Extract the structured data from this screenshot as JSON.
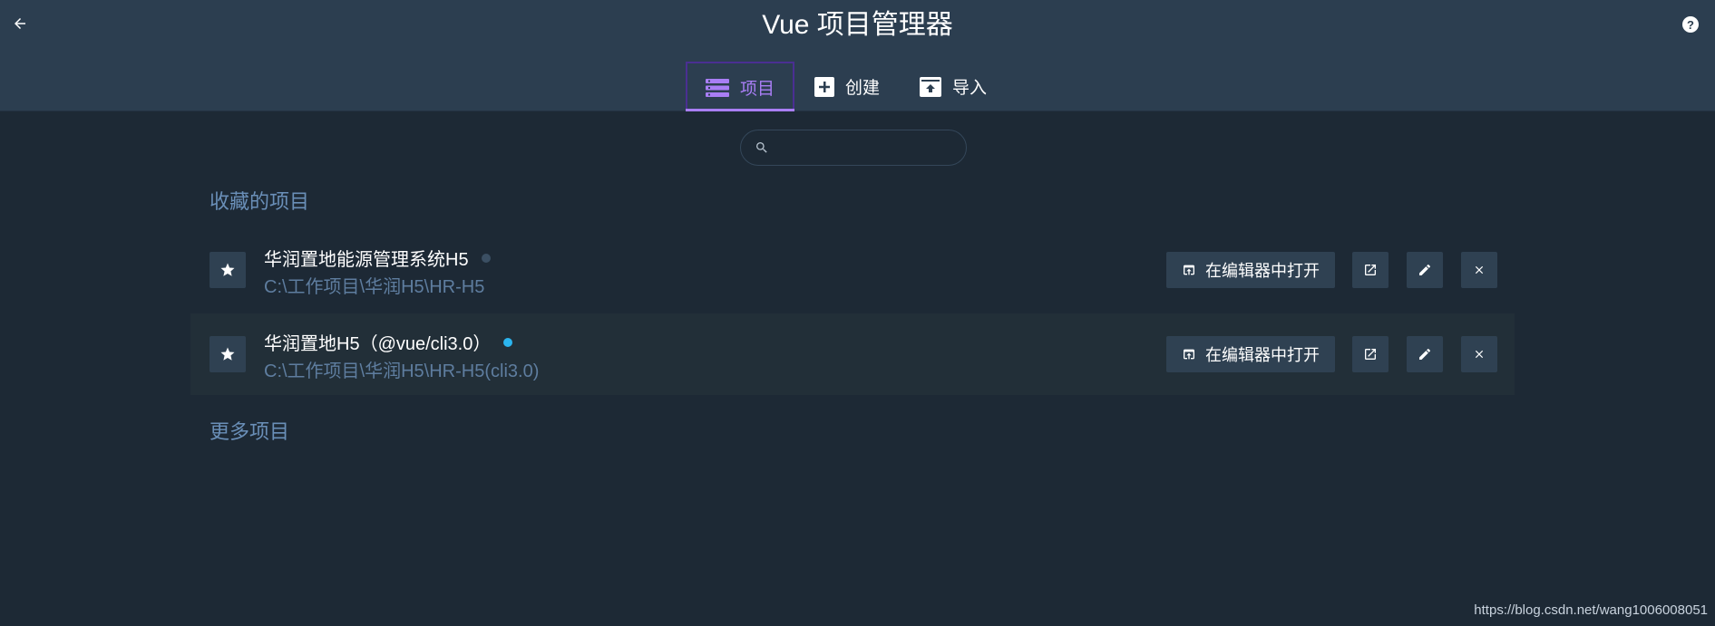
{
  "header": {
    "title": "Vue 项目管理器",
    "back_icon": "arrow-left-icon",
    "help_icon": "help-circle-icon",
    "help_label": "?"
  },
  "tabs": [
    {
      "label": "项目",
      "icon": "list-icon",
      "active": true
    },
    {
      "label": "创建",
      "icon": "add-box-icon",
      "active": false
    },
    {
      "label": "导入",
      "icon": "unarchive-icon",
      "active": false
    }
  ],
  "search": {
    "placeholder": "",
    "value": ""
  },
  "favorites": {
    "title": "收藏的项目",
    "projects": [
      {
        "name": "华润置地能源管理系统H5",
        "path": "C:\\工作项目\\华润H5\\HR-H5",
        "status_color": "#3b4f63"
      },
      {
        "name": "华润置地H5（@vue/cli3.0）",
        "path": "C:\\工作项目\\华润H5\\HR-H5(cli3.0)",
        "status_color": "#2bb5ef"
      }
    ]
  },
  "open_in_editor_label": "在编辑器中打开",
  "more_projects": {
    "title": "更多项目"
  },
  "watermark": "https://blog.csdn.net/wang1006008051",
  "colors": {
    "accent": "#a97ef5",
    "header_bg": "#2c3e50",
    "page_bg": "#1d2935"
  }
}
